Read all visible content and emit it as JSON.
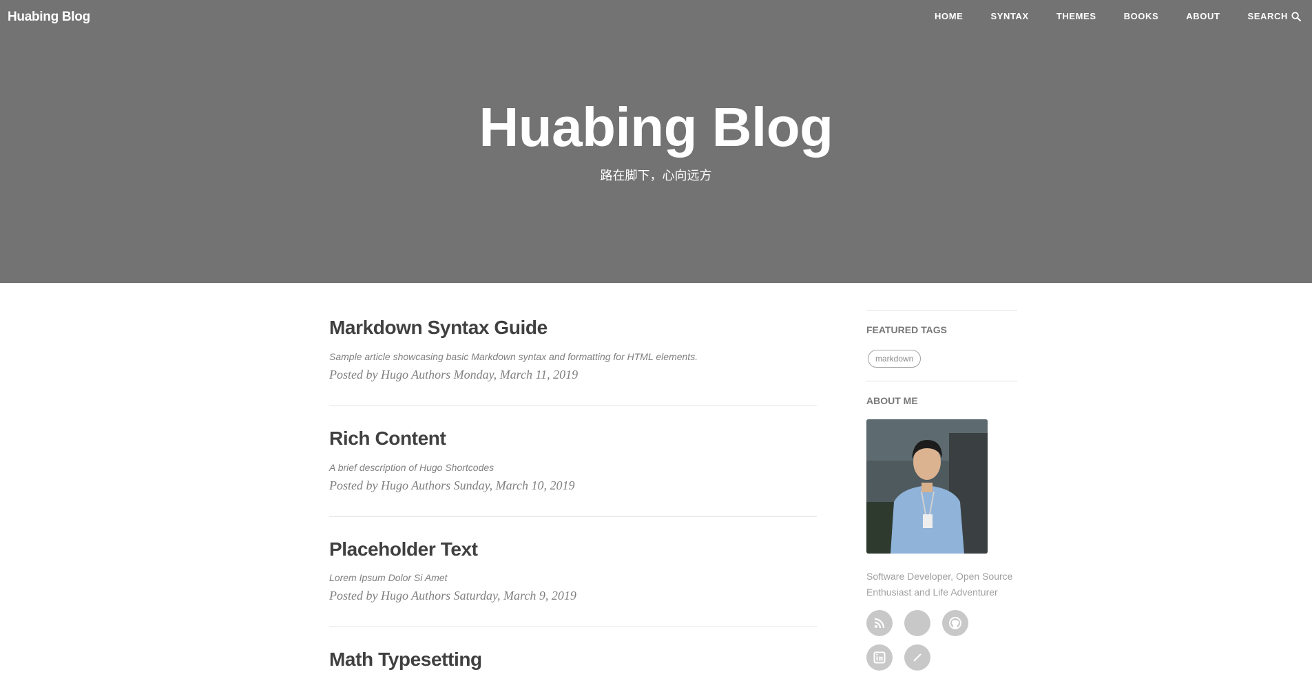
{
  "header": {
    "brand": "Huabing Blog",
    "nav": [
      {
        "label": "HOME"
      },
      {
        "label": "SYNTAX"
      },
      {
        "label": "THEMES"
      },
      {
        "label": "BOOKS"
      },
      {
        "label": "ABOUT"
      },
      {
        "label": "SEARCH"
      }
    ]
  },
  "hero": {
    "title": "Huabing Blog",
    "subtitle": "路在脚下，心向远方"
  },
  "posts": [
    {
      "title": "Markdown Syntax Guide",
      "description": "Sample article showcasing basic Markdown syntax and formatting for HTML elements.",
      "meta": "Posted by Hugo Authors Monday, March 11, 2019"
    },
    {
      "title": "Rich Content",
      "description": "A brief description of Hugo Shortcodes",
      "meta": "Posted by Hugo Authors Sunday, March 10, 2019"
    },
    {
      "title": "Placeholder Text",
      "description": "Lorem Ipsum Dolor Si Amet",
      "meta": "Posted by Hugo Authors Saturday, March 9, 2019"
    },
    {
      "title": "Math Typesetting"
    }
  ],
  "sidebar": {
    "featured_tags_heading": "FEATURED TAGS",
    "tags": [
      "markdown"
    ],
    "about_heading": "ABOUT ME",
    "about_text": "Software Developer, Open Source Enthusiast and Life Adventurer",
    "social_icons": [
      "rss-icon",
      "blank-icon",
      "github-icon",
      "linkedin-icon",
      "partial-icon"
    ]
  },
  "colors": {
    "hero_bg": "#737373",
    "text": "#404040",
    "muted": "#808080",
    "social_bg": "#c8c8c8"
  }
}
